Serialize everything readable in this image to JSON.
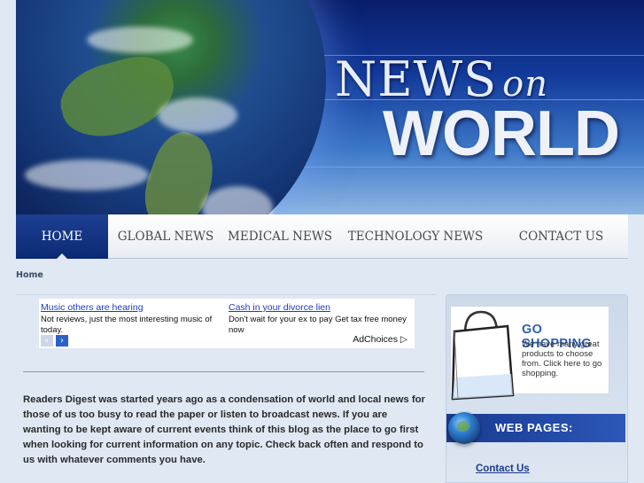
{
  "header": {
    "title_news": "NEWS",
    "title_on": "on",
    "title_world": "WORLD"
  },
  "nav": {
    "items": [
      {
        "label": "HOME",
        "active": true
      },
      {
        "label": "GLOBAL NEWS",
        "active": false
      },
      {
        "label": "MEDICAL NEWS",
        "active": false
      },
      {
        "label": "TECHNOLOGY NEWS",
        "active": false
      },
      {
        "label": "CONTACT US",
        "active": false
      }
    ]
  },
  "breadcrumb": "Home",
  "ad": {
    "items": [
      {
        "title": "Music others are hearing",
        "desc": "Not reviews, just the most interesting music of today."
      },
      {
        "title": "Cash in your divorce lien",
        "desc": "Don't wait for your ex to pay Get tax free money now"
      }
    ],
    "prev_icon": "chevron-left-icon",
    "next_icon": "chevron-right-icon",
    "adchoices_label": "AdChoices"
  },
  "main": {
    "body": "Readers Digest was started years ago as a condensation of world and local news for those of us too busy to read the paper or listen to broadcast news. If you are wanting to be kept aware of current events think of this blog as the place to go first when looking for current information on any topic. Check back often and respond to us with whatever comments you have."
  },
  "sidebar": {
    "shop_title": "GO SHOPPING",
    "shop_desc": "We have many great products to choose from. Click here to go shopping.",
    "webpages_label": "WEB PAGES:",
    "links": [
      "Contact Us"
    ]
  },
  "colors": {
    "nav_active": "#1c3f93",
    "link": "#1a3dbf",
    "page_bg": "#dfe8f3"
  }
}
